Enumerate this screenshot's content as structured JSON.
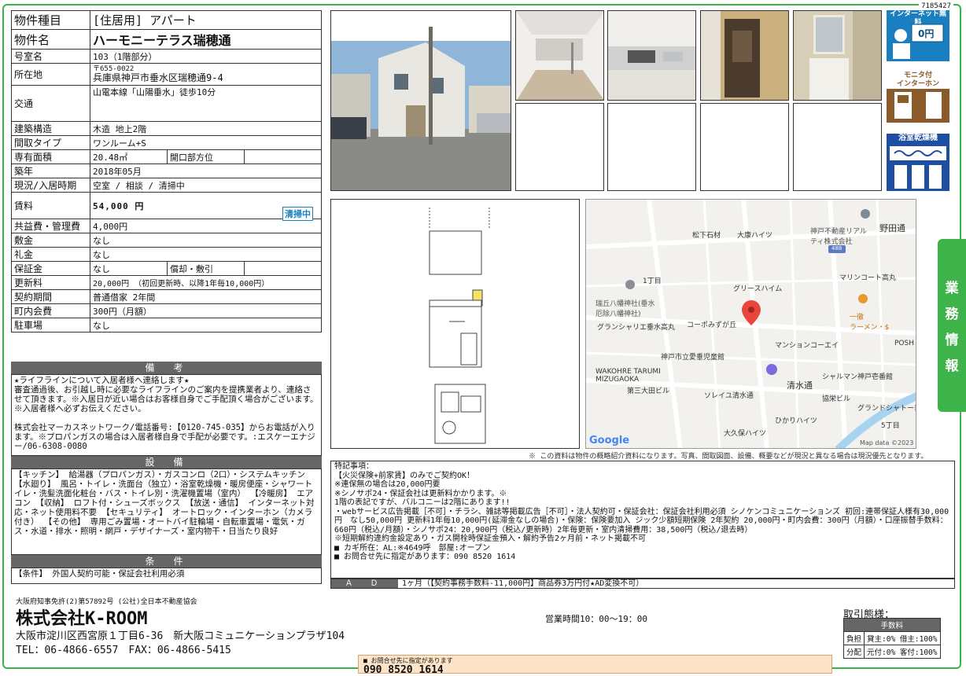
{
  "doc_id": "7185427",
  "property": {
    "rows": [
      {
        "label": "物件種目",
        "value": "[住居用] アパート"
      },
      {
        "label": "物件名",
        "value": "ハーモニーテラス瑞穂通"
      },
      {
        "label": "号室名",
        "value": "103（1階部分）"
      },
      {
        "label": "所在地",
        "postal": "〒655-0022",
        "value": "兵庫県神戸市垂水区瑞穂通9-4"
      },
      {
        "label": "交通",
        "value": "山電本線「山陽垂水」徒歩10分"
      },
      {
        "label": "建築構造",
        "value": "木造 地上2階"
      },
      {
        "label": "間取タイプ",
        "value": "ワンルーム+S"
      },
      {
        "label": "専有面積",
        "value": "20.48㎡",
        "sub_label": "開口部方位",
        "sub_value": ""
      },
      {
        "label": "築年",
        "value": "2018年05月"
      },
      {
        "label": "現況/入居時期",
        "value": "空室 / 相談 / 清掃中"
      },
      {
        "label": "賃料",
        "value": "54,000 円",
        "badge": "清掃中"
      },
      {
        "label": "共益費・管理費",
        "value": "4,000円"
      },
      {
        "label": "敷金",
        "value": "なし"
      },
      {
        "label": "礼金",
        "value": "なし"
      },
      {
        "label": "保証金",
        "value": "なし",
        "sub_label": "償却・敷引",
        "sub_value": ""
      },
      {
        "label": "更新料",
        "value": "20,000円 （初回更新時、以降1年毎10,000円）"
      },
      {
        "label": "契約期間",
        "value": "普通借家 2年間"
      },
      {
        "label": "町内会費",
        "value": "300円（月額）"
      },
      {
        "label": "駐車場",
        "value": "なし"
      }
    ]
  },
  "remarks": {
    "title": "備　考",
    "text": "★ライフラインについて入居者様へ連絡します★\n審査通過後、お引越し時に必要なライフラインのご案内を提携業者より、連絡させて頂きます。※入居日が近い場合はお客様自身でご手配頂く場合がございます。※入居者様へ必ずお伝えください。\n\n株式会社マーカスネットワーク/電話番号:【0120-745-035】からお電話が入ります。※プロパンガスの場合は入居者様自身で手配が必要です。:エスケーエナジー/06-6308-0080"
  },
  "equipment": {
    "title": "設　備",
    "text": "【キッチン】 給湯器（プロパンガス）・ガスコンロ（2口）・システムキッチン 【水廻り】 風呂・トイレ・洗面台（独立）・浴室乾燥機・暖房便座・シャワートイレ・洗髪洗面化粧台・バス・トイレ別・洗濯機置場（室内） 【冷暖房】 エアコン 【収納】 ロフト付・シューズボックス 【放送・通信】 インターネット対応・ネット使用料不要 【セキュリティ】 オートロック・インターホン（カメラ付き） 【その他】 専用ごみ置場・オートバイ駐輪場・自転車置場・電気・ガス・水道・排水・照明・網戸・デザイナーズ・室内物干・日当たり良好"
  },
  "conditions": {
    "title": "条　件",
    "text": "【条件】 外国人契約可能・保証会社利用必須"
  },
  "feature_icons": [
    {
      "name": "internet-free-icon",
      "label": "インターネット無料",
      "color": "#1a7fc1"
    },
    {
      "name": "monitor-intercom-icon",
      "label": "モニタ付\nインターホン",
      "color": "#8a5a2b"
    },
    {
      "name": "bathroom-dryer-icon",
      "label": "浴室乾燥機",
      "color": "#1f4fa3"
    }
  ],
  "map": {
    "labels": [
      "松下石材",
      "大康ハイツ",
      "神戸不動産リアル\nティ株式会社",
      "野田通",
      "488",
      "1丁目",
      "グリースハイム",
      "マリンコート高丸",
      "瑞丘八幡神社(垂水\n厄除八幡神社)",
      "一徹\nラーメン・$",
      "グランシャリエ垂水高丸",
      "コーポみずが丘",
      "神戸市立愛垂児童館",
      "マンションコーエイ",
      "POSH",
      "WAKOHRE TARUMI\nMIZUGAOKA",
      "シャルマン神戸壱番館",
      "第三大田ビル",
      "ソレイユ清水通",
      "清水通",
      "協栄ビル",
      "グランドシャトー垂水",
      "ひかりハイツ",
      "5丁目",
      "大久保ハイツ"
    ],
    "google": "Google",
    "attribution": "Map data ©2023"
  },
  "disclaimer": "※ この資料は物件の概略紹介資料になります。写真、間取図面、設備、概要などが現況と異なる場合は現況優先となります。",
  "notes": "特記事項：\n【火災保険+前家賃】のみでご契約OK！\n※連保無の場合は20,000円要\n※シノサポ24・保証会社は更新料かかります。※\n1階の表記ですが、バルコニーは2階にあります!!\n・webサービス広告掲載［不可］・チラシ、雑誌等掲載広告［不可］・法人契約可・保証会社：保証会社利用必須 シノケンコミュニケーションズ 初回:連帯保証人様有30,000円　なし50,000円 更新料1年毎10,000円(延滞金なしの場合)・保険：保険要加入 ジック少額短期保険 2年契約 20,000円・町内会費：300円（月額）・口座振替手数料：660円（税込/月額）・シノサポ24：20,900円（税込/更新時）2年毎更新・室内清掃費用：38,500円（税込/退去時）\n※短期解約違約金設定あり・ガス開栓時保証金預入・解約予告2ヶ月前・ネット掲載不可\n■ カギ所在：AL:※4649呼　部屋:オープン\n■ お問合せ先に指定があります：090 8520 1614",
  "ad": {
    "label": "Ａ Ｄ",
    "value": "1ヶ月（【契約事務手数料-11,000円】商品券3万円付★AD変換不可）"
  },
  "side_tab": [
    "業",
    "務",
    "情",
    "報"
  ],
  "footer": {
    "license": "大阪府知事免許(2)第57892号 (公社)全日本不動産協会",
    "company": "株式会社K-ROOM",
    "address": "大阪市淀川区西宮原１丁目6-36　新大阪コミュニケーションプラザ104",
    "tel": "TEL：06-4866-6557　FAX：06-4866-5415",
    "hours": "営業時間10：00～19：00",
    "torihiki_label": "取引態様：",
    "fee_head": "手数料",
    "fee_rows": [
      {
        "label": "負担",
        "value": "貸主:0% 借主:100%"
      },
      {
        "label": "分配",
        "value": "元付:0% 客付:100%"
      }
    ],
    "contact_note": "■ お問合せ先に指定があります",
    "contact_phone": "090 8520 1614"
  }
}
